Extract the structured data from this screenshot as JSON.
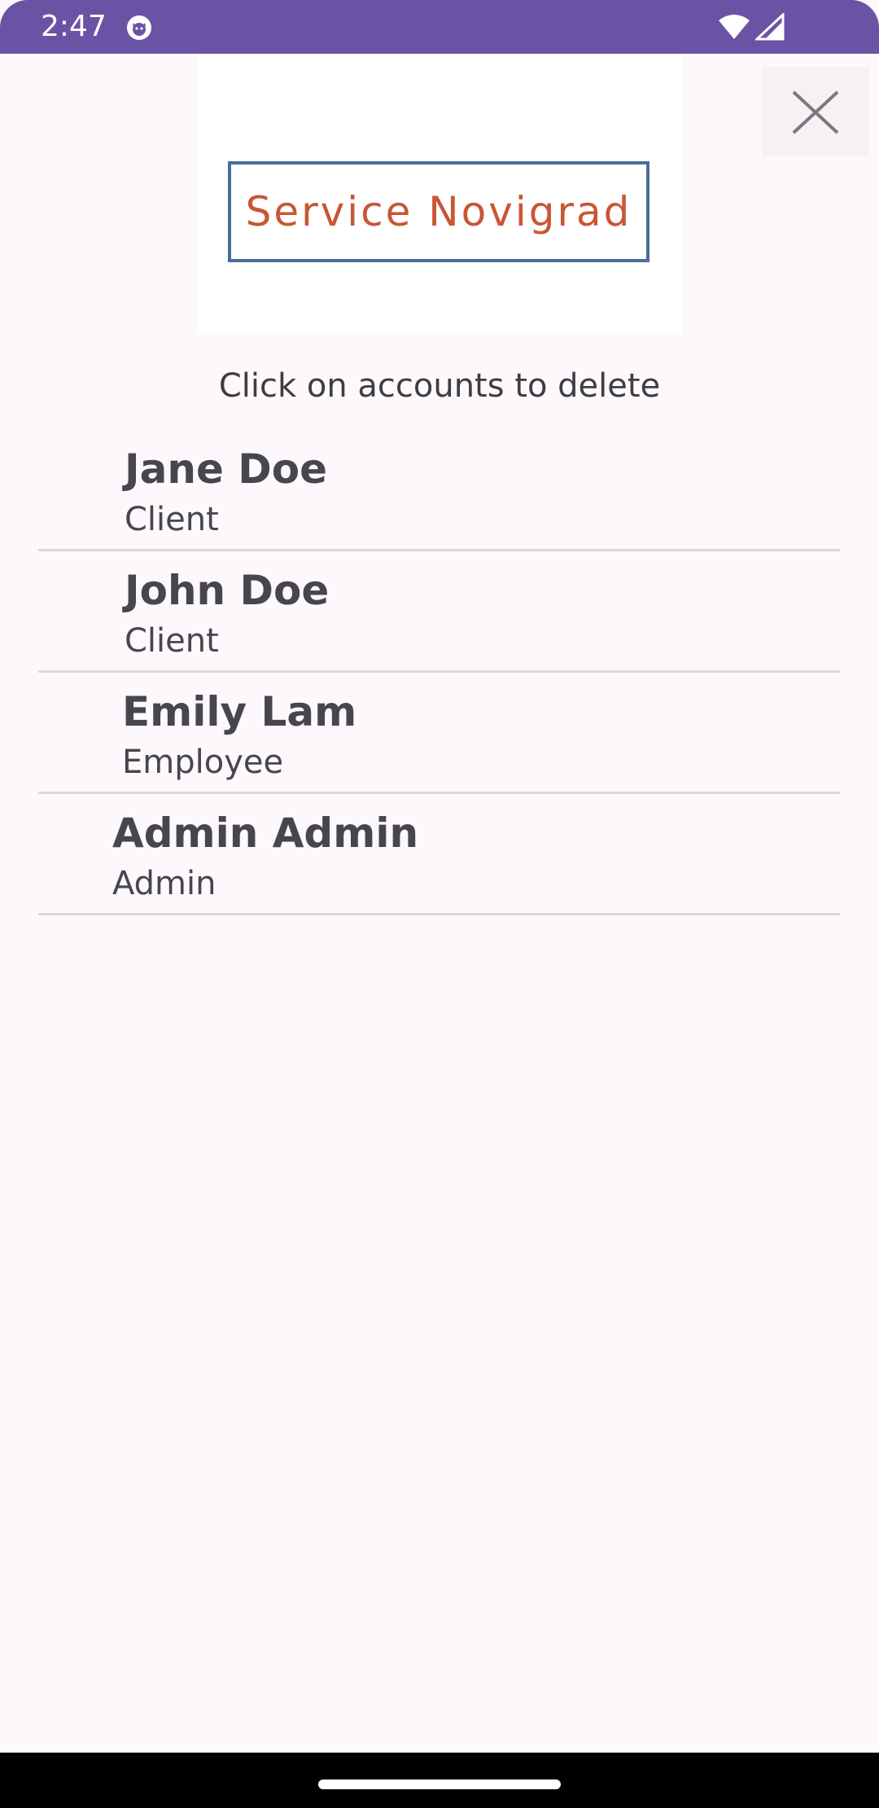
{
  "status_bar": {
    "time": "2:47",
    "icons": [
      "app-notification-icon",
      "wifi-icon",
      "cell-signal-icon"
    ]
  },
  "logo": {
    "text": "Service Novigrad"
  },
  "close_button": {
    "icon": "close-icon"
  },
  "instruction": "Click on accounts to delete",
  "accounts": [
    {
      "name": "Jane Doe",
      "role": "Client"
    },
    {
      "name": "John Doe",
      "role": "Client"
    },
    {
      "name": "Emily Lam",
      "role": "Employee"
    },
    {
      "name": "Admin Admin",
      "role": "Admin"
    }
  ],
  "colors": {
    "status_bar": "#6a53a4",
    "background": "#fcf8fb",
    "logo_text": "#c85634",
    "logo_border": "#4a6d9b",
    "text": "#47464c"
  }
}
